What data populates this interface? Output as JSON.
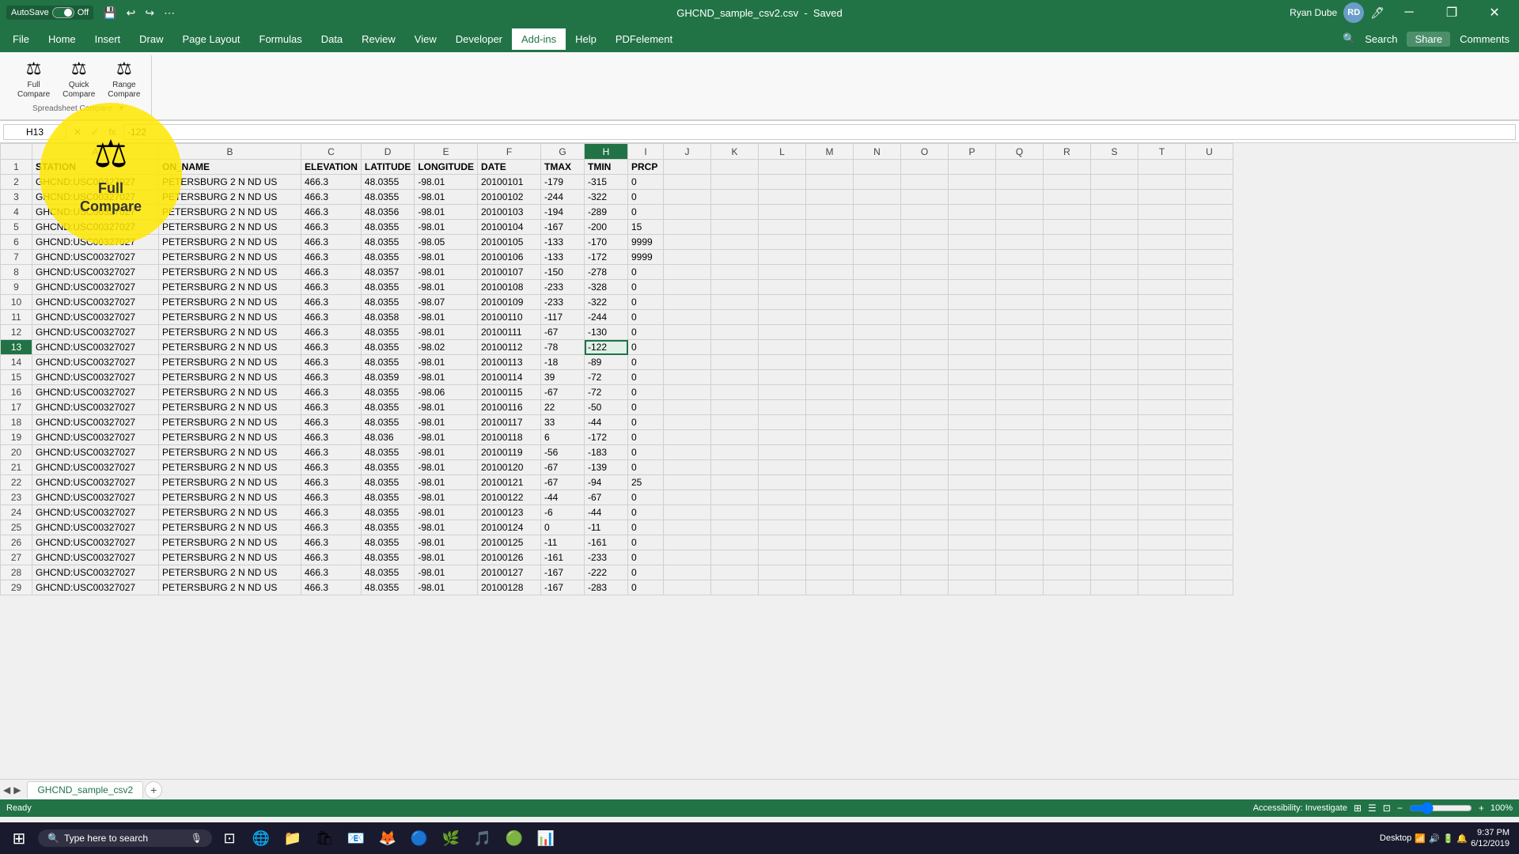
{
  "titleBar": {
    "autoSave": "AutoSave",
    "autoSaveState": "Off",
    "fileName": "GHCND_sample_csv2.csv",
    "savedStatus": "Saved",
    "userName": "Ryan Dube",
    "userInitials": "RD",
    "windowControls": {
      "minimize": "─",
      "restore": "❐",
      "close": "✕"
    }
  },
  "ribbon": {
    "tabs": [
      "File",
      "Home",
      "Insert",
      "Draw",
      "Page Layout",
      "Formulas",
      "Data",
      "Review",
      "View",
      "Developer",
      "Add-ins",
      "Help",
      "PDFelement"
    ],
    "activeTab": "Add-ins",
    "searchLabel": "Search",
    "shareLabel": "Share",
    "commentsLabel": "Comments",
    "groups": [
      {
        "label": "Spreadsheet Compare",
        "buttons": [
          {
            "id": "full-compare",
            "icon": "⚖",
            "label": "Full\nCompare"
          },
          {
            "id": "quick-compare",
            "icon": "⚖",
            "label": "Quick\nCompare"
          },
          {
            "id": "range-compare",
            "icon": "⚖",
            "label": "Range\nCompare"
          }
        ]
      }
    ]
  },
  "formulaBar": {
    "cellRef": "H13",
    "value": "-122"
  },
  "columns": [
    "A",
    "B",
    "C",
    "D",
    "E",
    "F",
    "G",
    "H",
    "I",
    "J",
    "K",
    "L",
    "M",
    "N",
    "O",
    "P",
    "Q",
    "R",
    "S",
    "T",
    "U"
  ],
  "headers": [
    "STATION",
    "ON_NAME",
    "ELEVATION",
    "LATITUDE",
    "LONGITUDE",
    "DATE",
    "TMAX",
    "TMIN",
    "PRCP"
  ],
  "rows": [
    [
      "GHCND:USC00327027",
      "PETERSBURG 2 N ND US",
      "466.3",
      "48.0355",
      "-98.01",
      "20100101",
      "-179",
      "-315",
      "0"
    ],
    [
      "GHCND:USC00327027",
      "PETERSBURG 2 N ND US",
      "466.3",
      "48.0355",
      "-98.01",
      "20100102",
      "-244",
      "-322",
      "0"
    ],
    [
      "GHCND:USC00327027",
      "PETERSBURG 2 N ND US",
      "466.3",
      "48.0356",
      "-98.01",
      "20100103",
      "-194",
      "-289",
      "0"
    ],
    [
      "GHCND:USC00327027",
      "PETERSBURG 2 N ND US",
      "466.3",
      "48.0355",
      "-98.01",
      "20100104",
      "-167",
      "-200",
      "15"
    ],
    [
      "GHCND:USC00327027",
      "PETERSBURG 2 N ND US",
      "466.3",
      "48.0355",
      "-98.05",
      "20100105",
      "-133",
      "-170",
      "9999"
    ],
    [
      "GHCND:USC00327027",
      "PETERSBURG 2 N ND US",
      "466.3",
      "48.0355",
      "-98.01",
      "20100106",
      "-133",
      "-172",
      "9999"
    ],
    [
      "GHCND:USC00327027",
      "PETERSBURG 2 N ND US",
      "466.3",
      "48.0357",
      "-98.01",
      "20100107",
      "-150",
      "-278",
      "0"
    ],
    [
      "GHCND:USC00327027",
      "PETERSBURG 2 N ND US",
      "466.3",
      "48.0355",
      "-98.01",
      "20100108",
      "-233",
      "-328",
      "0"
    ],
    [
      "GHCND:USC00327027",
      "PETERSBURG 2 N ND US",
      "466.3",
      "48.0355",
      "-98.07",
      "20100109",
      "-233",
      "-322",
      "0"
    ],
    [
      "GHCND:USC00327027",
      "PETERSBURG 2 N ND US",
      "466.3",
      "48.0358",
      "-98.01",
      "20100110",
      "-117",
      "-244",
      "0"
    ],
    [
      "GHCND:USC00327027",
      "PETERSBURG 2 N ND US",
      "466.3",
      "48.0355",
      "-98.01",
      "20100111",
      "-67",
      "-130",
      "0"
    ],
    [
      "GHCND:USC00327027",
      "PETERSBURG 2 N ND US",
      "466.3",
      "48.0355",
      "-98.02",
      "20100112",
      "-78",
      "-122",
      "0"
    ],
    [
      "GHCND:USC00327027",
      "PETERSBURG 2 N ND US",
      "466.3",
      "48.0355",
      "-98.01",
      "20100113",
      "-18",
      "-89",
      "0"
    ],
    [
      "GHCND:USC00327027",
      "PETERSBURG 2 N ND US",
      "466.3",
      "48.0359",
      "-98.01",
      "20100114",
      "39",
      "-72",
      "0"
    ],
    [
      "GHCND:USC00327027",
      "PETERSBURG 2 N ND US",
      "466.3",
      "48.0355",
      "-98.06",
      "20100115",
      "-67",
      "-72",
      "0"
    ],
    [
      "GHCND:USC00327027",
      "PETERSBURG 2 N ND US",
      "466.3",
      "48.0355",
      "-98.01",
      "20100116",
      "22",
      "-50",
      "0"
    ],
    [
      "GHCND:USC00327027",
      "PETERSBURG 2 N ND US",
      "466.3",
      "48.0355",
      "-98.01",
      "20100117",
      "33",
      "-44",
      "0"
    ],
    [
      "GHCND:USC00327027",
      "PETERSBURG 2 N ND US",
      "466.3",
      "48.036",
      "-98.01",
      "20100118",
      "6",
      "-172",
      "0"
    ],
    [
      "GHCND:USC00327027",
      "PETERSBURG 2 N ND US",
      "466.3",
      "48.0355",
      "-98.01",
      "20100119",
      "-56",
      "-183",
      "0"
    ],
    [
      "GHCND:USC00327027",
      "PETERSBURG 2 N ND US",
      "466.3",
      "48.0355",
      "-98.01",
      "20100120",
      "-67",
      "-139",
      "0"
    ],
    [
      "GHCND:USC00327027",
      "PETERSBURG 2 N ND US",
      "466.3",
      "48.0355",
      "-98.01",
      "20100121",
      "-67",
      "-94",
      "25"
    ],
    [
      "GHCND:USC00327027",
      "PETERSBURG 2 N ND US",
      "466.3",
      "48.0355",
      "-98.01",
      "20100122",
      "-44",
      "-67",
      "0"
    ],
    [
      "GHCND:USC00327027",
      "PETERSBURG 2 N ND US",
      "466.3",
      "48.0355",
      "-98.01",
      "20100123",
      "-6",
      "-44",
      "0"
    ],
    [
      "GHCND:USC00327027",
      "PETERSBURG 2 N ND US",
      "466.3",
      "48.0355",
      "-98.01",
      "20100124",
      "0",
      "-11",
      "0"
    ],
    [
      "GHCND:USC00327027",
      "PETERSBURG 2 N ND US",
      "466.3",
      "48.0355",
      "-98.01",
      "20100125",
      "-11",
      "-161",
      "0"
    ],
    [
      "GHCND:USC00327027",
      "PETERSBURG 2 N ND US",
      "466.3",
      "48.0355",
      "-98.01",
      "20100126",
      "-161",
      "-233",
      "0"
    ],
    [
      "GHCND:USC00327027",
      "PETERSBURG 2 N ND US",
      "466.3",
      "48.0355",
      "-98.01",
      "20100127",
      "-167",
      "-222",
      "0"
    ],
    [
      "GHCND:USC00327027",
      "PETERSBURG 2 N ND US",
      "466.3",
      "48.0355",
      "-98.01",
      "20100128",
      "-167",
      "-283",
      "0"
    ]
  ],
  "selectedCell": {
    "row": 13,
    "col": 7
  },
  "sheetTabs": [
    "GHCND_sample_csv2"
  ],
  "activeSheet": "GHCND_sample_csv2",
  "statusBar": {
    "mode": "Ready",
    "accessibilityLabel": "Accessibility: Investigate",
    "viewNormal": "⊞",
    "viewLayout": "☰",
    "viewPage": "⊡",
    "zoomOut": "−",
    "zoomIn": "+",
    "zoom": "100",
    "zoomPercent": "%"
  },
  "spotlight": {
    "icon": "⚖",
    "line1": "Full",
    "line2": "Compare"
  },
  "taskbar": {
    "startIcon": "⊞",
    "searchPlaceholder": "Type here to search",
    "micIcon": "🎤",
    "icons": [
      "📋",
      "🌐",
      "📁",
      "🛍",
      "📦",
      "📧",
      "🦊",
      "🎮",
      "🌿",
      "🎵",
      "🟢"
    ],
    "time": "9:37 PM",
    "date": "6/12/2019",
    "desktopLabel": "Desktop",
    "batteryIcon": "🔋",
    "networkIcon": "📶",
    "volumeIcon": "🔊",
    "notifIcon": "🔔"
  }
}
